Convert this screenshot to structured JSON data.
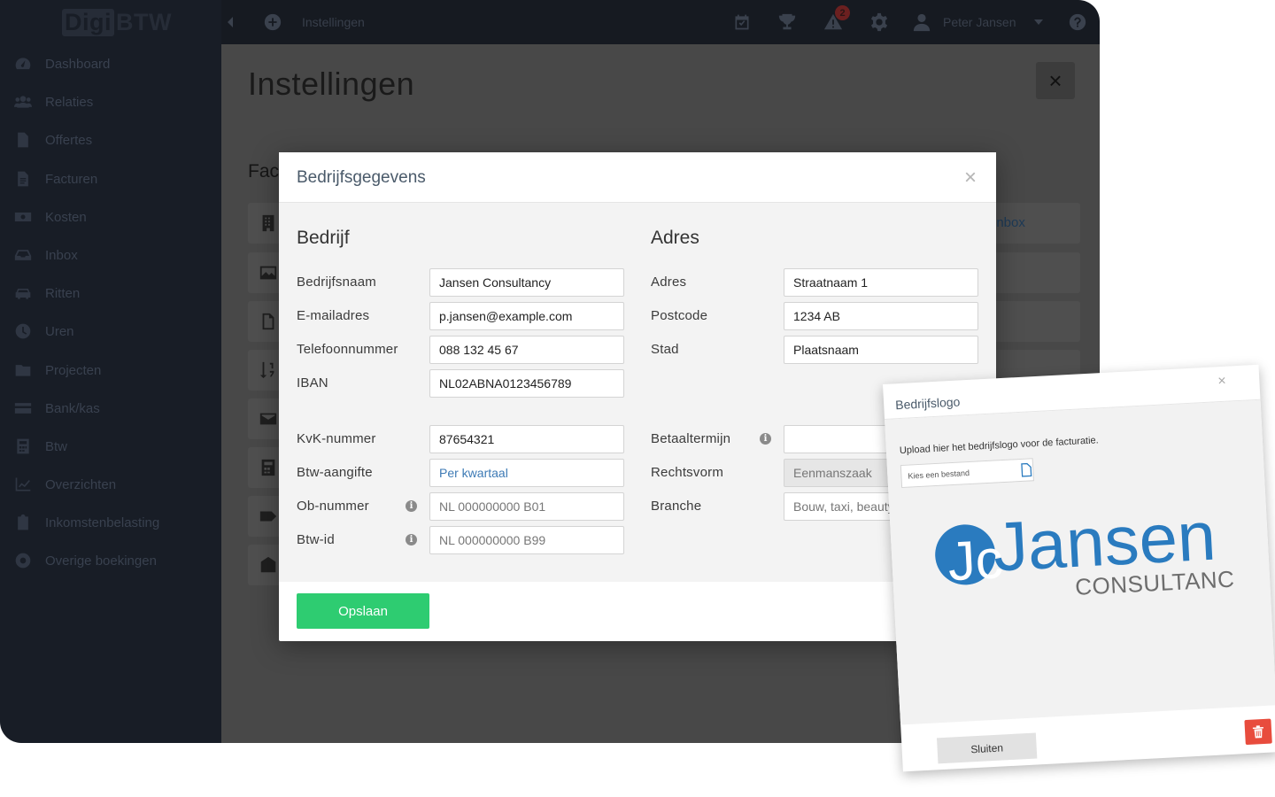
{
  "app": {
    "logo": {
      "part1": "Digi",
      "part2": "BTW"
    },
    "sidebar": {
      "items": [
        {
          "label": "Dashboard",
          "icon": "dashboard-icon"
        },
        {
          "label": "Relaties",
          "icon": "users-icon"
        },
        {
          "label": "Offertes",
          "icon": "document-icon"
        },
        {
          "label": "Facturen",
          "icon": "invoice-icon"
        },
        {
          "label": "Kosten",
          "icon": "money-icon"
        },
        {
          "label": "Inbox",
          "icon": "inbox-icon"
        },
        {
          "label": "Ritten",
          "icon": "car-icon"
        },
        {
          "label": "Uren",
          "icon": "clock-icon"
        },
        {
          "label": "Projecten",
          "icon": "folder-icon"
        },
        {
          "label": "Bank/kas",
          "icon": "credit-card-icon"
        },
        {
          "label": "Btw",
          "icon": "calculator-icon"
        },
        {
          "label": "Overzichten",
          "icon": "chart-icon"
        },
        {
          "label": "Inkomstenbelasting",
          "icon": "clipboard-icon"
        },
        {
          "label": "Overige boekingen",
          "icon": "lifebuoy-icon"
        }
      ]
    },
    "topbar": {
      "breadcrumb": "Instellingen",
      "notifications_count": "2",
      "user_name": "Peter Jansen"
    },
    "page": {
      "title": "Instellingen",
      "section_title": "Fact",
      "inbox_link": "inbox",
      "close_symbol": "×"
    }
  },
  "modal": {
    "title": "Bedrijfsgegevens",
    "close_symbol": "×",
    "company": {
      "section_title": "Bedrijf",
      "fields": {
        "name": {
          "label": "Bedrijfsnaam",
          "value": "Jansen Consultancy"
        },
        "email": {
          "label": "E-mailadres",
          "value": "p.jansen@example.com"
        },
        "phone": {
          "label": "Telefoonnummer",
          "value": "088 132 45 67"
        },
        "iban": {
          "label": "IBAN",
          "value": "NL02ABNA0123456789"
        },
        "kvk": {
          "label": "KvK-nummer",
          "value": "87654321"
        },
        "btw_aangifte": {
          "label": "Btw-aangifte",
          "value": "Per kwartaal"
        },
        "ob_nummer": {
          "label": "Ob-nummer",
          "placeholder": "NL 000000000 B01"
        },
        "btw_id": {
          "label": "Btw-id",
          "placeholder": "NL 000000000 B99"
        }
      }
    },
    "address": {
      "section_title": "Adres",
      "fields": {
        "adres": {
          "label": "Adres",
          "value": "Straatnaam 1"
        },
        "postcode": {
          "label": "Postcode",
          "value": "1234 AB"
        },
        "stad": {
          "label": "Stad",
          "value": "Plaatsnaam"
        },
        "betaaltermijn": {
          "label": "Betaaltermijn",
          "value": ""
        },
        "rechtsvorm": {
          "label": "Rechtsvorm",
          "value": "Eenmanszaak"
        },
        "branche": {
          "label": "Branche",
          "value": "Bouw, taxi, beauty"
        }
      }
    },
    "save_label": "Opslaan"
  },
  "logo_popup": {
    "title": "Bedrijfslogo",
    "close_symbol": "×",
    "instruction": "Upload hier het bedrijfslogo voor de facturatie.",
    "file_placeholder": "Kies een bestand",
    "logo_text": {
      "initials": "Jc",
      "name": "Jansen",
      "sub": "CONSULTANCY"
    },
    "close_label": "Sluiten",
    "colors": {
      "logo_blue": "#2a7bbf",
      "logo_grey": "#6d6d6d",
      "delete_red": "#e84c3d"
    }
  },
  "colors": {
    "save_green": "#2ecc71",
    "sidebar_bg": "#181d26"
  }
}
